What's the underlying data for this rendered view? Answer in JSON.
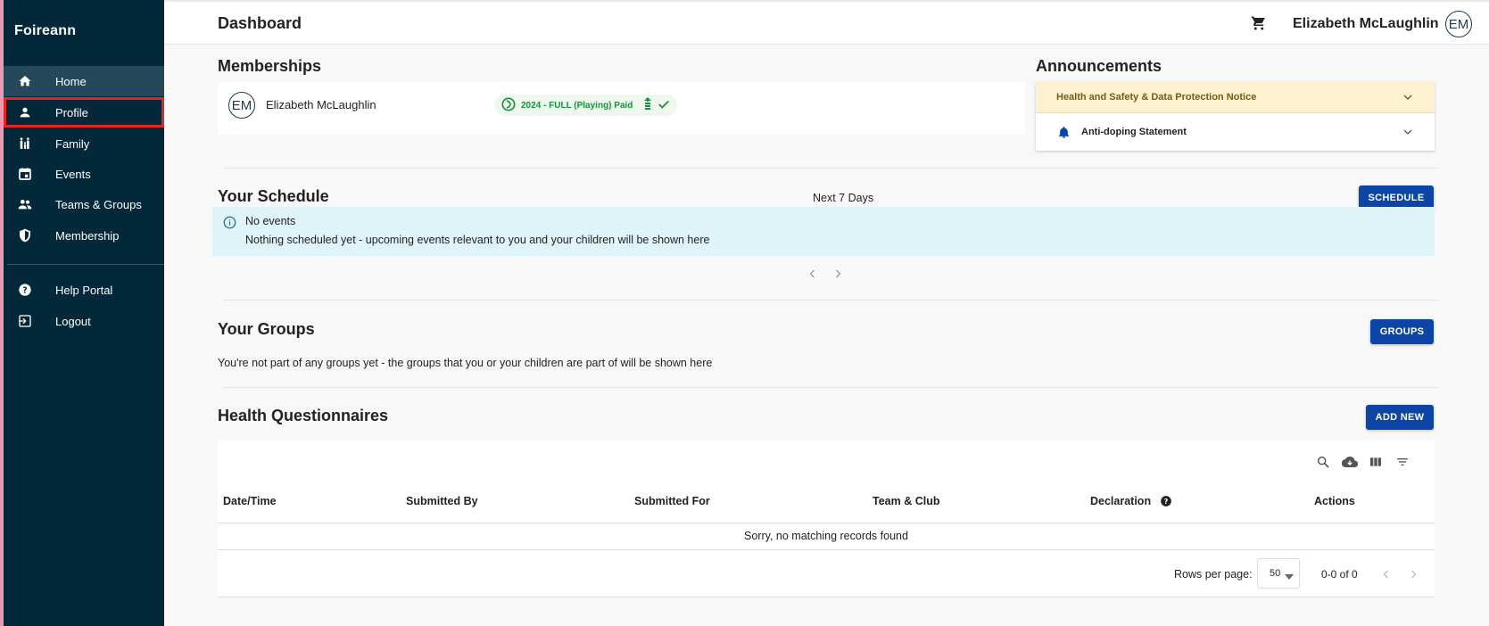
{
  "sidebar": {
    "brand": "Foireann",
    "items": [
      {
        "label": "Home",
        "icon": "home-icon"
      },
      {
        "label": "Profile",
        "icon": "person-icon"
      },
      {
        "label": "Family",
        "icon": "family-icon"
      },
      {
        "label": "Events",
        "icon": "calendar-icon"
      },
      {
        "label": "Teams & Groups",
        "icon": "groups-icon"
      },
      {
        "label": "Membership",
        "icon": "shield-icon"
      }
    ],
    "footer_items": [
      {
        "label": "Help Portal",
        "icon": "help-icon"
      },
      {
        "label": "Logout",
        "icon": "logout-icon"
      }
    ]
  },
  "header": {
    "title": "Dashboard",
    "user_name": "Elizabeth McLaughlin",
    "avatar_initials": "EM"
  },
  "memberships": {
    "title": "Memberships",
    "member_name": "Elizabeth McLaughlin",
    "member_initials": "EM",
    "status_chip": "2024 - FULL (Playing) Paid"
  },
  "announcements": {
    "title": "Announcements",
    "items": [
      {
        "label": "Health and Safety & Data Protection Notice"
      },
      {
        "label": "Anti-doping Statement"
      }
    ]
  },
  "schedule": {
    "title": "Your Schedule",
    "range_label": "Next 7 Days",
    "button_label": "SCHEDULE",
    "info_title": "No events",
    "info_text": "Nothing scheduled yet - upcoming events relevant to you and your children will be shown here"
  },
  "groups": {
    "title": "Your Groups",
    "button_label": "GROUPS",
    "empty_text": "You're not part of any groups yet - the groups that you or your children are part of will be shown here"
  },
  "health": {
    "title": "Health Questionnaires",
    "button_label": "ADD NEW",
    "columns": [
      "Date/Time",
      "Submitted By",
      "Submitted For",
      "Team & Club",
      "Declaration",
      "Actions"
    ],
    "empty_text": "Sorry, no matching records found",
    "rows_per_page_label": "Rows per page:",
    "rows_per_page_value": "50",
    "pagination_text": "0-0 of 0"
  },
  "colors": {
    "sidebar_bg": "#02283a",
    "primary_button": "#0b45a6",
    "info_bg": "#dff4f9",
    "notice_bg": "#fdf1cf",
    "chip_green": "#1a8f3c",
    "highlight_red": "#e3261f"
  }
}
